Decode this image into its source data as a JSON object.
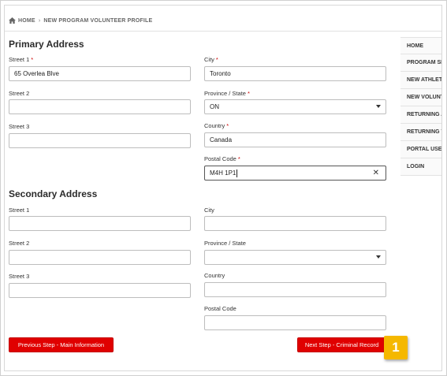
{
  "breadcrumb": {
    "home": "HOME",
    "current": "NEW PROGRAM VOLUNTEER PROFILE",
    "separator": "›"
  },
  "primary": {
    "title": "Primary Address",
    "street1": {
      "label": "Street 1",
      "value": "65 Overlea Blve"
    },
    "street2": {
      "label": "Street 2",
      "value": ""
    },
    "street3": {
      "label": "Street 3",
      "value": ""
    },
    "city": {
      "label": "City",
      "value": "Toronto"
    },
    "province": {
      "label": "Province / State",
      "value": "ON"
    },
    "country": {
      "label": "Country",
      "value": "Canada"
    },
    "postal": {
      "label": "Postal Code",
      "value": "M4H 1P1"
    },
    "required_mark": "*"
  },
  "secondary": {
    "title": "Secondary Address",
    "street1": {
      "label": "Street 1",
      "value": ""
    },
    "street2": {
      "label": "Street 2",
      "value": ""
    },
    "street3": {
      "label": "Street 3",
      "value": ""
    },
    "city": {
      "label": "City",
      "value": ""
    },
    "province": {
      "label": "Province / State",
      "value": ""
    },
    "country": {
      "label": "Country",
      "value": ""
    },
    "postal": {
      "label": "Postal Code",
      "value": ""
    }
  },
  "side_nav": {
    "items": [
      {
        "label": "HOME"
      },
      {
        "label": "PROGRAM SE"
      },
      {
        "label": "NEW ATHLET"
      },
      {
        "label": "NEW VOLUNT"
      },
      {
        "label": "RETURNING A"
      },
      {
        "label": "RETURNING V"
      },
      {
        "label": "PORTAL USEI"
      },
      {
        "label": "LOGIN"
      }
    ]
  },
  "buttons": {
    "prev": "Previous Step - Main Information",
    "next": "Next Step - Criminal Record"
  },
  "callout": {
    "number": "1"
  },
  "icons": {
    "home": "home-icon",
    "clear": "clear-icon",
    "dropdown": "chevron-down-icon"
  },
  "colors": {
    "primary_button": "#e00000",
    "callout": "#f5b800",
    "required": "#cc0000"
  }
}
